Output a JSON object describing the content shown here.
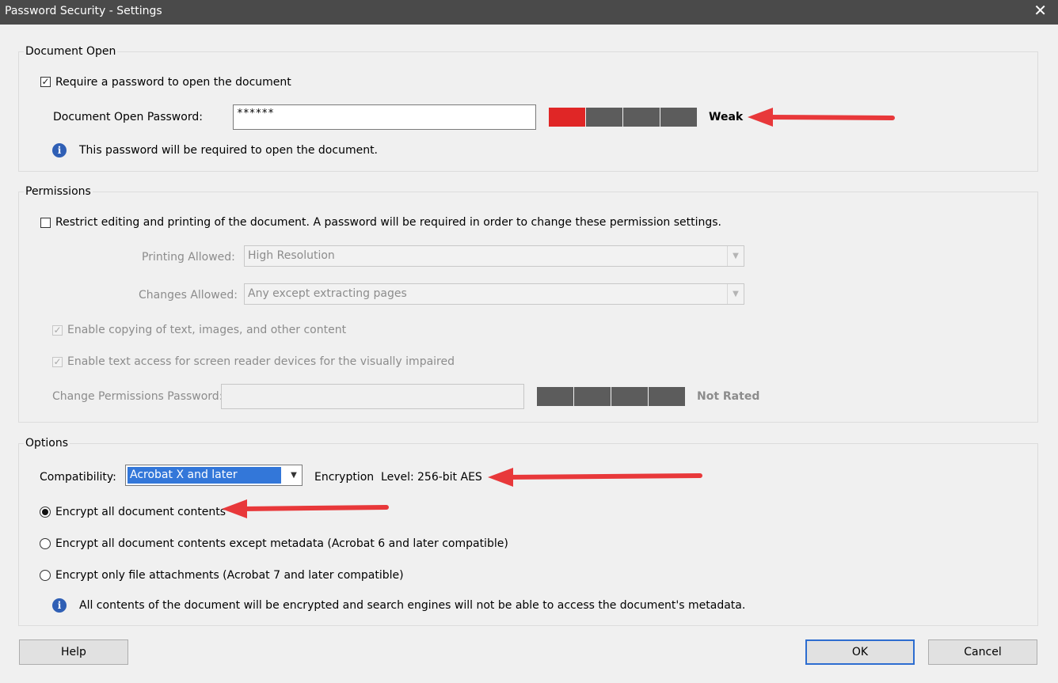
{
  "window": {
    "title": "Password Security - Settings",
    "close_glyph": "✕"
  },
  "document_open": {
    "legend": "Document Open",
    "require_password_label": "Require a password to open the document",
    "require_password_checked": true,
    "password_label": "Document Open Password:",
    "password_value": "******",
    "strength_label": "Weak",
    "strength_level": 1,
    "strength_max": 4,
    "info_text": "This password will be required to open the document."
  },
  "permissions": {
    "legend": "Permissions",
    "restrict_label": "Restrict editing and printing of the document. A password will be required in order to change these permission settings.",
    "restrict_checked": false,
    "printing_label": "Printing Allowed:",
    "printing_value": "High Resolution",
    "changes_label": "Changes Allowed:",
    "changes_value": "Any except extracting pages",
    "copy_label": "Enable copying of text, images, and other content",
    "screen_reader_label": "Enable text access for screen reader devices for the visually impaired",
    "perm_password_label": "Change Permissions Password:",
    "perm_password_value": "",
    "perm_strength_label": "Not Rated"
  },
  "options": {
    "legend": "Options",
    "compatibility_label": "Compatibility:",
    "compatibility_value": "Acrobat X and later",
    "encryption_level_label": "Encryption  Level:",
    "encryption_level_value": "256-bit AES",
    "radio_all": "Encrypt all document contents",
    "radio_except_metadata": "Encrypt all document contents except metadata (Acrobat 6 and later compatible)",
    "radio_attachments": "Encrypt only file attachments (Acrobat 7 and later compatible)",
    "selected_radio": "radio_all",
    "info_text": "All contents of the document will be encrypted and search engines will not be able to access the document's metadata."
  },
  "buttons": {
    "help": "Help",
    "ok": "OK",
    "cancel": "Cancel"
  },
  "colors": {
    "annotation_arrow": "#e8383a",
    "strength_weak": "#e02626",
    "selection": "#3377d9"
  }
}
